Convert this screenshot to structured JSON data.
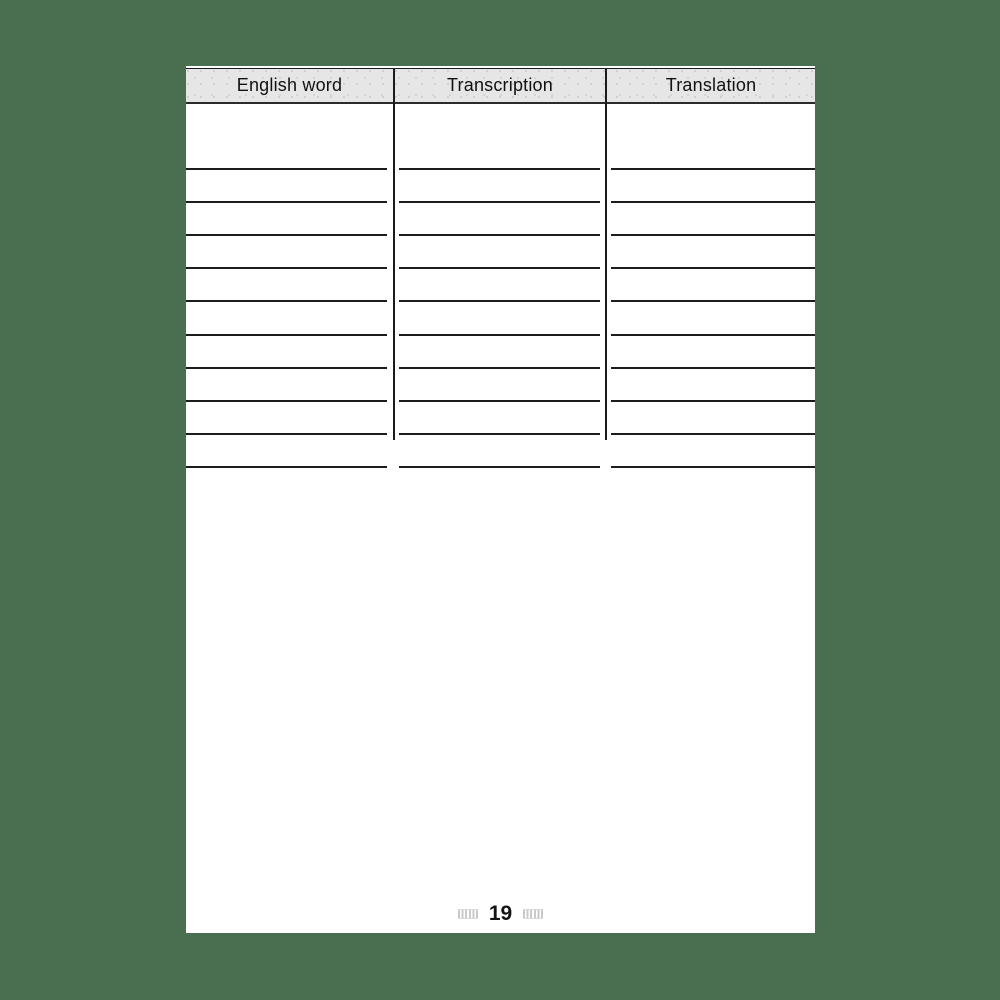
{
  "document": {
    "type": "vocabulary-worksheet",
    "background_color": "#4a6f50",
    "page_color": "#ffffff"
  },
  "table": {
    "header_background": "#e6e6e6",
    "line_color": "#1c1c1c",
    "columns": [
      {
        "label": "English word"
      },
      {
        "label": "Transcription"
      },
      {
        "label": "Translation"
      }
    ],
    "row_count": 10,
    "rows": [
      {
        "english_word": "",
        "transcription": "",
        "translation": ""
      },
      {
        "english_word": "",
        "transcription": "",
        "translation": ""
      },
      {
        "english_word": "",
        "transcription": "",
        "translation": ""
      },
      {
        "english_word": "",
        "transcription": "",
        "translation": ""
      },
      {
        "english_word": "",
        "transcription": "",
        "translation": ""
      },
      {
        "english_word": "",
        "transcription": "",
        "translation": ""
      },
      {
        "english_word": "",
        "transcription": "",
        "translation": ""
      },
      {
        "english_word": "",
        "transcription": "",
        "translation": ""
      },
      {
        "english_word": "",
        "transcription": "",
        "translation": ""
      },
      {
        "english_word": "",
        "transcription": "",
        "translation": ""
      }
    ]
  },
  "footer": {
    "page_number": "19",
    "ornament_left": "hatch-ornament-icon",
    "ornament_right": "hatch-ornament-icon"
  }
}
